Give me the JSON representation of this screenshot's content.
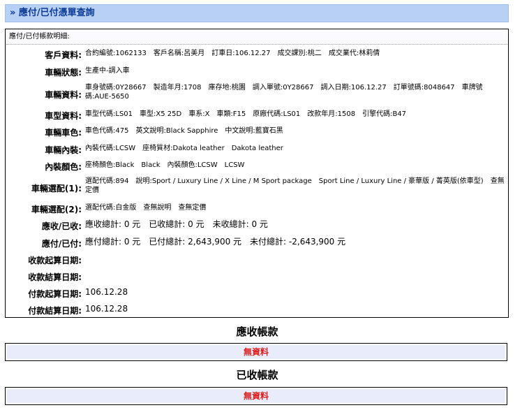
{
  "header": {
    "title": "» 應付/已付憑單查詢"
  },
  "detail": {
    "caption": "應付/已付帳款明細:",
    "rows": [
      {
        "label": "客戶資料:",
        "value": "合約編號:1062133　客戶名稱:呂美月　訂車日:106.12.27　成交課別:桃二　成交業代:林莉倩"
      },
      {
        "label": "車輛狀態:",
        "value": "生產中-調入車"
      },
      {
        "label": "車輛資料:",
        "value": "車身號碼:0Y28667　製造年月:1708　庫存地:桃園　調入單號:0Y28667　調入日期:106.12.27　訂單號碼:8048647　車牌號碼:AUE-5650"
      },
      {
        "label": "車型資料:",
        "value": "車型代碼:LS01　車型:X5 25D　車系:X　車類:F15　原廠代碼:LS01　改款年月:1508　引擎代碼:B47"
      },
      {
        "label": "車輛車色:",
        "value": "車色代碼:475　英文說明:Black Sapphire　中文說明:藍寶石黑"
      },
      {
        "label": "車輛內裝:",
        "value": "內裝代碼:LCSW　座椅質材:Dakota leather　Dakota leather"
      },
      {
        "label": "內裝顏色:",
        "value": "座椅顏色:Black　Black　內裝顏色:LCSW　LCSW"
      },
      {
        "label": "車輛選配(1):",
        "value": "選配代碼:894　說明:Sport / Luxury Line / X Line / M Sport package　Sport Line / Luxury Line / 豪華版 / 菁英版(依車型)　查無定價"
      },
      {
        "label": "車輛選配(2):",
        "value": "選配代碼:白金版　查無說明　查無定價"
      },
      {
        "label": "應收/已收:",
        "value": "應收總計: 0 元　已收總計: 0 元　未收總計: 0 元"
      },
      {
        "label": "應付/已付:",
        "value": "應付總計: 0 元　已付總計: 2,643,900 元　未付總計: -2,643,900 元"
      },
      {
        "label": "收款起算日期:",
        "value": ""
      },
      {
        "label": "收款結算日期:",
        "value": ""
      },
      {
        "label": "付款起算日期:",
        "value": "106.12.28"
      },
      {
        "label": "付款結算日期:",
        "value": "106.12.28"
      }
    ]
  },
  "receivable": {
    "title": "應收帳款",
    "empty": "無資料"
  },
  "received": {
    "title": "已收帳款",
    "empty": "無資料"
  }
}
